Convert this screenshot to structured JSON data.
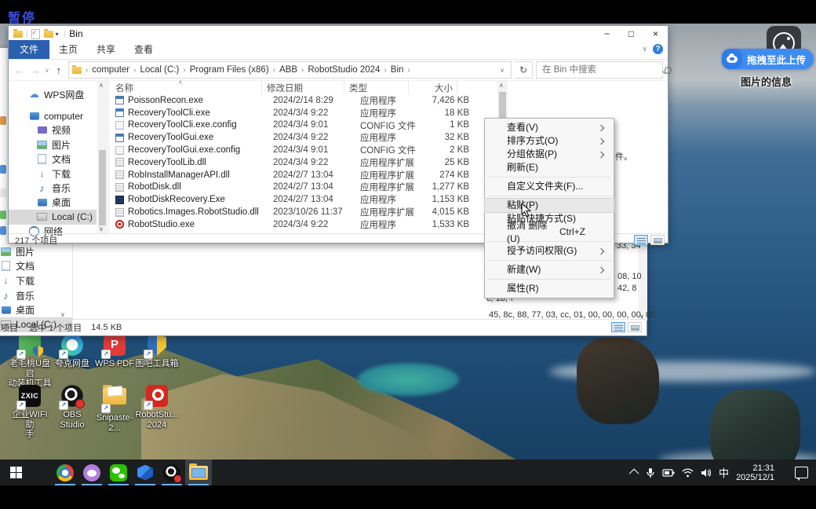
{
  "overlay": {
    "pause_label": "暂停",
    "upload_button": "拖拽至此上传",
    "caption": "图片的信息"
  },
  "colors": {
    "accent_blue": "#2f7fe0",
    "tab_active_blue": "#2b5fb0",
    "upload_blue": "#3f8cf0",
    "taskbar_bg": "#1b1d1f",
    "taskbar_underline": "#6cb1e8",
    "selection_gray": "#d9d9d9"
  },
  "front_window": {
    "title": "Bin",
    "window_buttons": {
      "minimize": "−",
      "maximize": "□",
      "close": "×"
    },
    "ribbon_tabs": [
      {
        "label": "文件",
        "active": true
      },
      {
        "label": "主页",
        "active": false
      },
      {
        "label": "共享",
        "active": false
      },
      {
        "label": "查看",
        "active": false
      }
    ],
    "breadcrumb": [
      "computer",
      "Local (C:)",
      "Program Files (x86)",
      "ABB",
      "RobotStudio 2024",
      "Bin"
    ],
    "search_placeholder": "在 Bin 中搜索",
    "sidebar": [
      {
        "label": "WPS网盘",
        "icon": "cloud-icon"
      },
      {
        "label": "computer",
        "icon": "monitor-icon"
      },
      {
        "label": "视频",
        "icon": "video-icon"
      },
      {
        "label": "图片",
        "icon": "picture-icon"
      },
      {
        "label": "文档",
        "icon": "document-icon"
      },
      {
        "label": "下载",
        "icon": "download-icon"
      },
      {
        "label": "音乐",
        "icon": "music-icon"
      },
      {
        "label": "桌面",
        "icon": "desktop-icon"
      },
      {
        "label": "Local (C:)",
        "icon": "drive-icon",
        "selected": true
      },
      {
        "label": "网络",
        "icon": "network-icon"
      }
    ],
    "columns": {
      "name": "名称",
      "date": "修改日期",
      "type": "类型",
      "size": "大小"
    },
    "files": [
      {
        "name": "PoissonRecon.exe",
        "date": "2024/2/14 8:29",
        "type": "应用程序",
        "size": "7,426 KB",
        "icon": "app-icon"
      },
      {
        "name": "RecoveryToolCli.exe",
        "date": "2024/3/4 9:22",
        "type": "应用程序",
        "size": "18 KB",
        "icon": "app-icon"
      },
      {
        "name": "RecoveryToolCli.exe.config",
        "date": "2024/3/4 9:01",
        "type": "CONFIG 文件",
        "size": "1 KB",
        "icon": "config-file-icon"
      },
      {
        "name": "RecoveryToolGui.exe",
        "date": "2024/3/4 9:22",
        "type": "应用程序",
        "size": "32 KB",
        "icon": "app-icon"
      },
      {
        "name": "RecoveryToolGui.exe.config",
        "date": "2024/3/4 9:01",
        "type": "CONFIG 文件",
        "size": "2 KB",
        "icon": "config-file-icon"
      },
      {
        "name": "RecoveryToolLib.dll",
        "date": "2024/3/4 9:22",
        "type": "应用程序扩展",
        "size": "25 KB",
        "icon": "dll-icon"
      },
      {
        "name": "RobInstallManagerAPI.dll",
        "date": "2024/2/7 13:04",
        "type": "应用程序扩展",
        "size": "274 KB",
        "icon": "dll-icon"
      },
      {
        "name": "RobotDisk.dll",
        "date": "2024/2/7 13:04",
        "type": "应用程序扩展",
        "size": "1,277 KB",
        "icon": "dll-icon"
      },
      {
        "name": "RobotDiskRecovery.Exe",
        "date": "2024/2/7 13:04",
        "type": "应用程序",
        "size": "1,153 KB",
        "icon": "app-dark-icon"
      },
      {
        "name": "Robotics.Images.RobotStudio.dll",
        "date": "2023/10/26 11:37",
        "type": "应用程序扩展",
        "size": "4,015 KB",
        "icon": "dll-icon"
      },
      {
        "name": "RobotStudio.exe",
        "date": "2024/3/4 9:22",
        "type": "应用程序",
        "size": "1,533 KB",
        "icon": "robotstudio-icon"
      }
    ],
    "status_left": "217 个项目",
    "preview_fragment": "件。"
  },
  "context_menu": {
    "items": [
      {
        "label": "查看(V)",
        "submenu": true
      },
      {
        "label": "排序方式(O)",
        "submenu": true
      },
      {
        "label": "分组依据(P)",
        "submenu": true
      },
      {
        "label": "刷新(E)",
        "submenu": false
      },
      {
        "label": "自定义文件夹(F)...",
        "submenu": false
      },
      {
        "label": "粘贴(P)",
        "submenu": false,
        "highlighted": true
      },
      {
        "label": "粘贴快捷方式(S)",
        "submenu": false
      },
      {
        "label": "撤消 删除(U)",
        "shortcut": "Ctrl+Z",
        "submenu": false
      },
      {
        "label": "授予访问权限(G)",
        "submenu": true
      },
      {
        "label": "新建(W)",
        "submenu": true
      },
      {
        "label": "属性(R)",
        "submenu": false
      }
    ]
  },
  "back_window": {
    "sidebar": [
      {
        "label": "图片",
        "icon": "picture-icon"
      },
      {
        "label": "文档",
        "icon": "document-icon"
      },
      {
        "label": "下载",
        "icon": "download-icon"
      },
      {
        "label": "音乐",
        "icon": "music-icon"
      },
      {
        "label": "桌面",
        "icon": "desktop-icon"
      },
      {
        "label": "Local (C:)",
        "icon": "drive-icon",
        "selected": true
      }
    ],
    "status": {
      "left": "项目",
      "middle": "选中 1 个项目",
      "right": "14.5 KB"
    },
    "preview_fragments": [
      "33, 34",
      "08, 10",
      "42, 8",
      "c, 1b, \\",
      "45, 8c, 88, 77, 03, cc, 01, 00, 00, 00, 00, 00"
    ]
  },
  "desktop_icons": [
    {
      "label": "老毛桃U盘启\n动装机工具",
      "icon": "laomaotao-icon"
    },
    {
      "label": "夸克网盘",
      "icon": "quark-netdisk-icon"
    },
    {
      "label": "WPS PDF",
      "icon": "wps-pdf-icon"
    },
    {
      "label": "图吧工具箱",
      "icon": "tuba-toolbox-icon"
    },
    {
      "label": "企业WIFI助\n手",
      "icon": "zxic-wifi-icon",
      "icon_text": "ZXIC"
    },
    {
      "label": "OBS Studio",
      "icon": "obs-studio-icon"
    },
    {
      "label": "Snipaste-2...",
      "icon": "snipaste-folder-icon"
    },
    {
      "label": "RobotStu...\n2024",
      "icon": "robotstudio-2024-icon"
    }
  ],
  "taskbar": {
    "apps": [
      {
        "name": "start",
        "icon": "start-icon"
      },
      {
        "name": "chrome",
        "icon": "chrome-icon"
      },
      {
        "name": "cat-app",
        "icon": "cat-app-icon"
      },
      {
        "name": "wechat",
        "icon": "wechat-icon"
      },
      {
        "name": "robotstudio",
        "icon": "robotstudio-cube-icon"
      },
      {
        "name": "obs",
        "icon": "obs-icon"
      },
      {
        "name": "explorer",
        "icon": "explorer-icon",
        "active": true
      }
    ],
    "tray": {
      "ime": "中",
      "time": "21:31",
      "date": "2025/12/1"
    }
  }
}
